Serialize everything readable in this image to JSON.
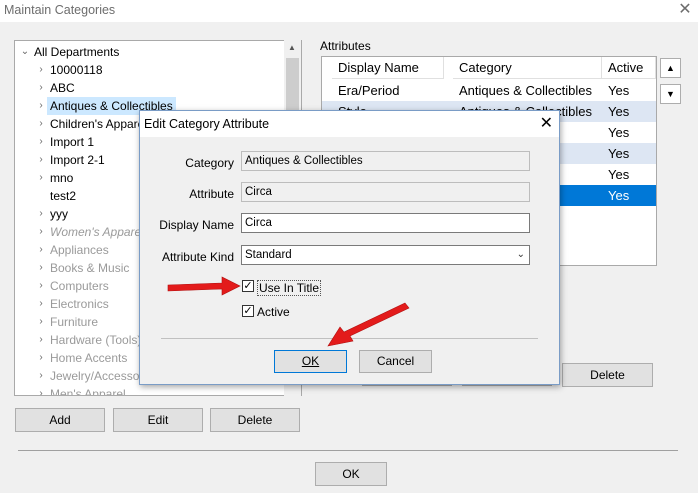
{
  "window": {
    "title": "Maintain Categories",
    "close_glyph": "✕"
  },
  "tree": {
    "items": [
      {
        "label": "All Departments",
        "arrow": "⌄",
        "style": "normal"
      },
      {
        "label": "10000118",
        "arrow": "›",
        "style": "normal"
      },
      {
        "label": "ABC",
        "arrow": "›",
        "style": "normal"
      },
      {
        "label": "Antiques & Collectibles",
        "arrow": "›",
        "style": "sel"
      },
      {
        "label": "Children's Apparel/G",
        "arrow": "›",
        "style": "normal"
      },
      {
        "label": "Import 1",
        "arrow": "›",
        "style": "normal"
      },
      {
        "label": "Import 2-1",
        "arrow": "›",
        "style": "normal"
      },
      {
        "label": "mno",
        "arrow": "›",
        "style": "normal"
      },
      {
        "label": "test2",
        "arrow": "",
        "style": "normal"
      },
      {
        "label": "yyy",
        "arrow": "›",
        "style": "normal"
      },
      {
        "label": "Women's Apparel",
        "arrow": "›",
        "style": "ital"
      },
      {
        "label": "Appliances",
        "arrow": "›",
        "style": "dim"
      },
      {
        "label": "Books & Music",
        "arrow": "›",
        "style": "dim"
      },
      {
        "label": "Computers",
        "arrow": "›",
        "style": "dim"
      },
      {
        "label": "Electronics",
        "arrow": "›",
        "style": "dim"
      },
      {
        "label": "Furniture",
        "arrow": "›",
        "style": "dim"
      },
      {
        "label": "Hardware (Tools)",
        "arrow": "›",
        "style": "dim"
      },
      {
        "label": "Home Accents",
        "arrow": "›",
        "style": "dim"
      },
      {
        "label": "Jewelry/Accessories",
        "arrow": "›",
        "style": "dim"
      },
      {
        "label": "Men's Apparel",
        "arrow": "›",
        "style": "dim"
      }
    ],
    "scroll_up": "▲"
  },
  "left_buttons": {
    "add": "Add",
    "edit": "Edit",
    "delete": "Delete"
  },
  "attributes": {
    "label": "Attributes",
    "columns": [
      "Display Name",
      "Category",
      "Active"
    ],
    "rows": [
      {
        "display_name": "Era/Period",
        "category": "Antiques & Collectibles",
        "active": "Yes",
        "style": "normal"
      },
      {
        "display_name": "Style",
        "category": "Antiques & Collectibles",
        "active": "Yes",
        "style": "alt"
      },
      {
        "display_name": "",
        "category": "ctibles",
        "active": "Yes",
        "style": "normal"
      },
      {
        "display_name": "",
        "category": "ctibles",
        "active": "Yes",
        "style": "alt"
      },
      {
        "display_name": "",
        "category": "ctibles",
        "active": "Yes",
        "style": "normal"
      },
      {
        "display_name": "",
        "category": "ctibles",
        "active": "Yes",
        "style": "sel"
      }
    ],
    "move_up": "▲",
    "move_down": "▼",
    "delete_label": "Delete"
  },
  "footer": {
    "ok_label": "OK"
  },
  "dialog": {
    "title": "Edit Category Attribute",
    "close_glyph": "✕",
    "category_label": "Category",
    "category_value": "Antiques & Collectibles",
    "attribute_label": "Attribute",
    "attribute_value": "Circa",
    "display_name_label": "Display Name",
    "display_name_value": "Circa",
    "attribute_kind_label": "Attribute Kind",
    "attribute_kind_value": "Standard",
    "use_in_title_label": "Use In Title",
    "use_in_title_checked": true,
    "active_label": "Active",
    "active_checked": true,
    "ok_label": "OK",
    "cancel_label": "Cancel"
  },
  "colors": {
    "selection_blue": "#0078d7",
    "tree_selection": "#cce8ff",
    "arrow_red": "#e31b1b"
  }
}
